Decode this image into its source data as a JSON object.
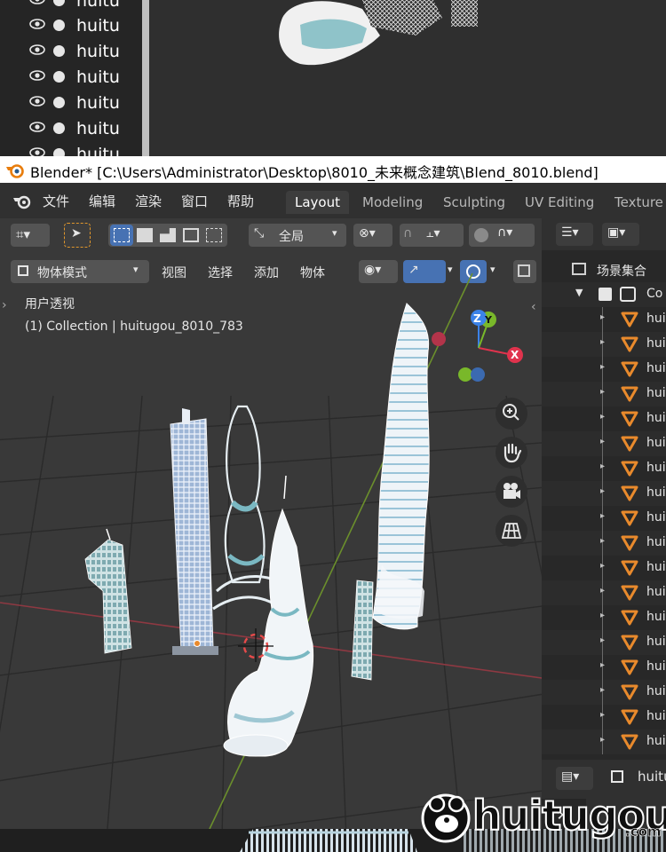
{
  "top_outliner": {
    "rows": [
      {
        "name": "huitu"
      },
      {
        "name": "huitu"
      },
      {
        "name": "huitu"
      },
      {
        "name": "huitu"
      },
      {
        "name": "huitu"
      },
      {
        "name": "huitu"
      },
      {
        "name": "huitu"
      }
    ]
  },
  "titlebar": {
    "title": "Blender* [C:\\Users\\Administrator\\Desktop\\8010_未来概念建筑\\Blend_8010.blend]"
  },
  "menubar": {
    "items": [
      "文件",
      "编辑",
      "渲染",
      "窗口",
      "帮助"
    ],
    "workspaces": [
      {
        "label": "Layout",
        "active": true
      },
      {
        "label": "Modeling",
        "active": false
      },
      {
        "label": "Sculpting",
        "active": false
      },
      {
        "label": "UV Editing",
        "active": false
      },
      {
        "label": "Texture",
        "active": false
      }
    ]
  },
  "toolbar": {
    "transform_orientation": "全局",
    "mode": "物体模式",
    "menus": [
      "视图",
      "选择",
      "添加",
      "物体"
    ]
  },
  "viewport": {
    "view_name": "用户透视",
    "collection_info": "(1) Collection | huitugou_8010_783",
    "gizmo": {
      "x": "X",
      "y": "Y",
      "z": "Z"
    }
  },
  "outliner": {
    "scene_collection": "场景集合",
    "collection": "Co",
    "objects": [
      "hui",
      "hui",
      "hui",
      "hui",
      "hui",
      "hui",
      "hui",
      "hui",
      "hui",
      "hui",
      "hui",
      "hui",
      "hui",
      "hui",
      "hui",
      "hui",
      "hui",
      "hui"
    ]
  },
  "properties": {
    "label": "huitu"
  },
  "watermark": {
    "text": "huitugou",
    "suffix": ".com"
  },
  "colors": {
    "accent_blue": "#4772b3",
    "object_orange": "#e98a2c",
    "axis_x": "#e0334d",
    "axis_y": "#79b82a",
    "axis_z": "#3b82e8"
  }
}
